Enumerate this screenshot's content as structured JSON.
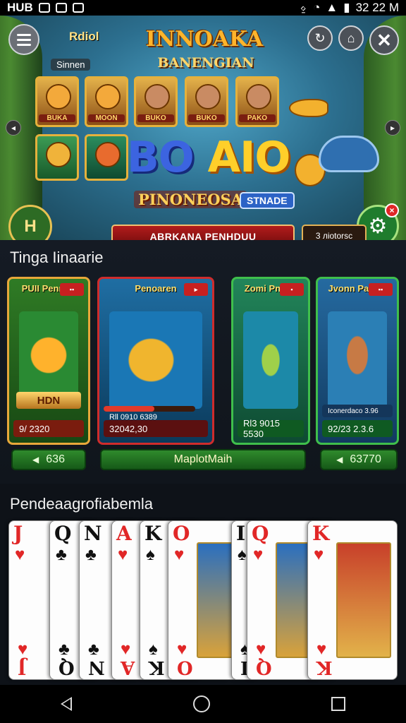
{
  "status_bar": {
    "carrier": "HUB",
    "time": "32 22 M"
  },
  "banner": {
    "tag_top": "Rdiol",
    "tag_pill": "Sinnen",
    "title": "INNOAKA",
    "subtitle": "BANENGIAN",
    "thumbs_row1": [
      "BUKA",
      "MOON",
      "BUKO",
      "BUKO",
      "PAKO"
    ],
    "bo": "BO",
    "aio": "AIO",
    "big_subtitle": "PINONEOSA",
    "stage_badge": "STNADE",
    "cta": "ABRKANA PENHDUU",
    "side_button": "3 лiotorsc",
    "left_button": "H"
  },
  "section1": {
    "title": "Tinga Iinaarie",
    "cards": [
      {
        "header": "PUII Penram",
        "name": "HDN",
        "foot": "9/ 2320"
      },
      {
        "header": "Penoaren",
        "name": "",
        "foot": "32042,30"
      },
      {
        "header": "Zomi Pnimo",
        "name": "",
        "foot": "Rl3 9015 5530"
      },
      {
        "header": "Jvonn Parroe",
        "name": "",
        "foot": "92/23 2.3.6"
      }
    ],
    "card2_slider_text": "Rll 0910 6389",
    "card4_slider_text": "Iconerdaco 3.96",
    "bar_left": "636",
    "bar_center": "MaplotMaih",
    "bar_right": "63770"
  },
  "section2": {
    "title": "Pendeaagrofiabemla",
    "cards": [
      {
        "rank": "J",
        "suit": "♥",
        "color": "red"
      },
      {
        "rank": "Q",
        "suit": "♣",
        "color": "black"
      },
      {
        "rank": "N",
        "suit": "♣",
        "color": "black"
      },
      {
        "rank": "A",
        "suit": "♥",
        "color": "red"
      },
      {
        "rank": "K",
        "suit": "♠",
        "color": "black"
      },
      {
        "rank": "O",
        "suit": "♥",
        "color": "red"
      },
      {
        "rank": "I",
        "suit": "♠",
        "color": "black"
      },
      {
        "rank": "Q",
        "suit": "♥",
        "color": "red"
      },
      {
        "rank": "K",
        "suit": "♥",
        "color": "red"
      }
    ]
  },
  "icons": {
    "menu": "hamburger-icon",
    "refresh": "refresh-icon",
    "bell": "bell-icon",
    "close": "close-icon",
    "settings": "gear-icon"
  },
  "colors": {
    "gold": "#e5b13c",
    "cta_red": "#b21c1c",
    "green_pill": "#2f8a2c"
  }
}
